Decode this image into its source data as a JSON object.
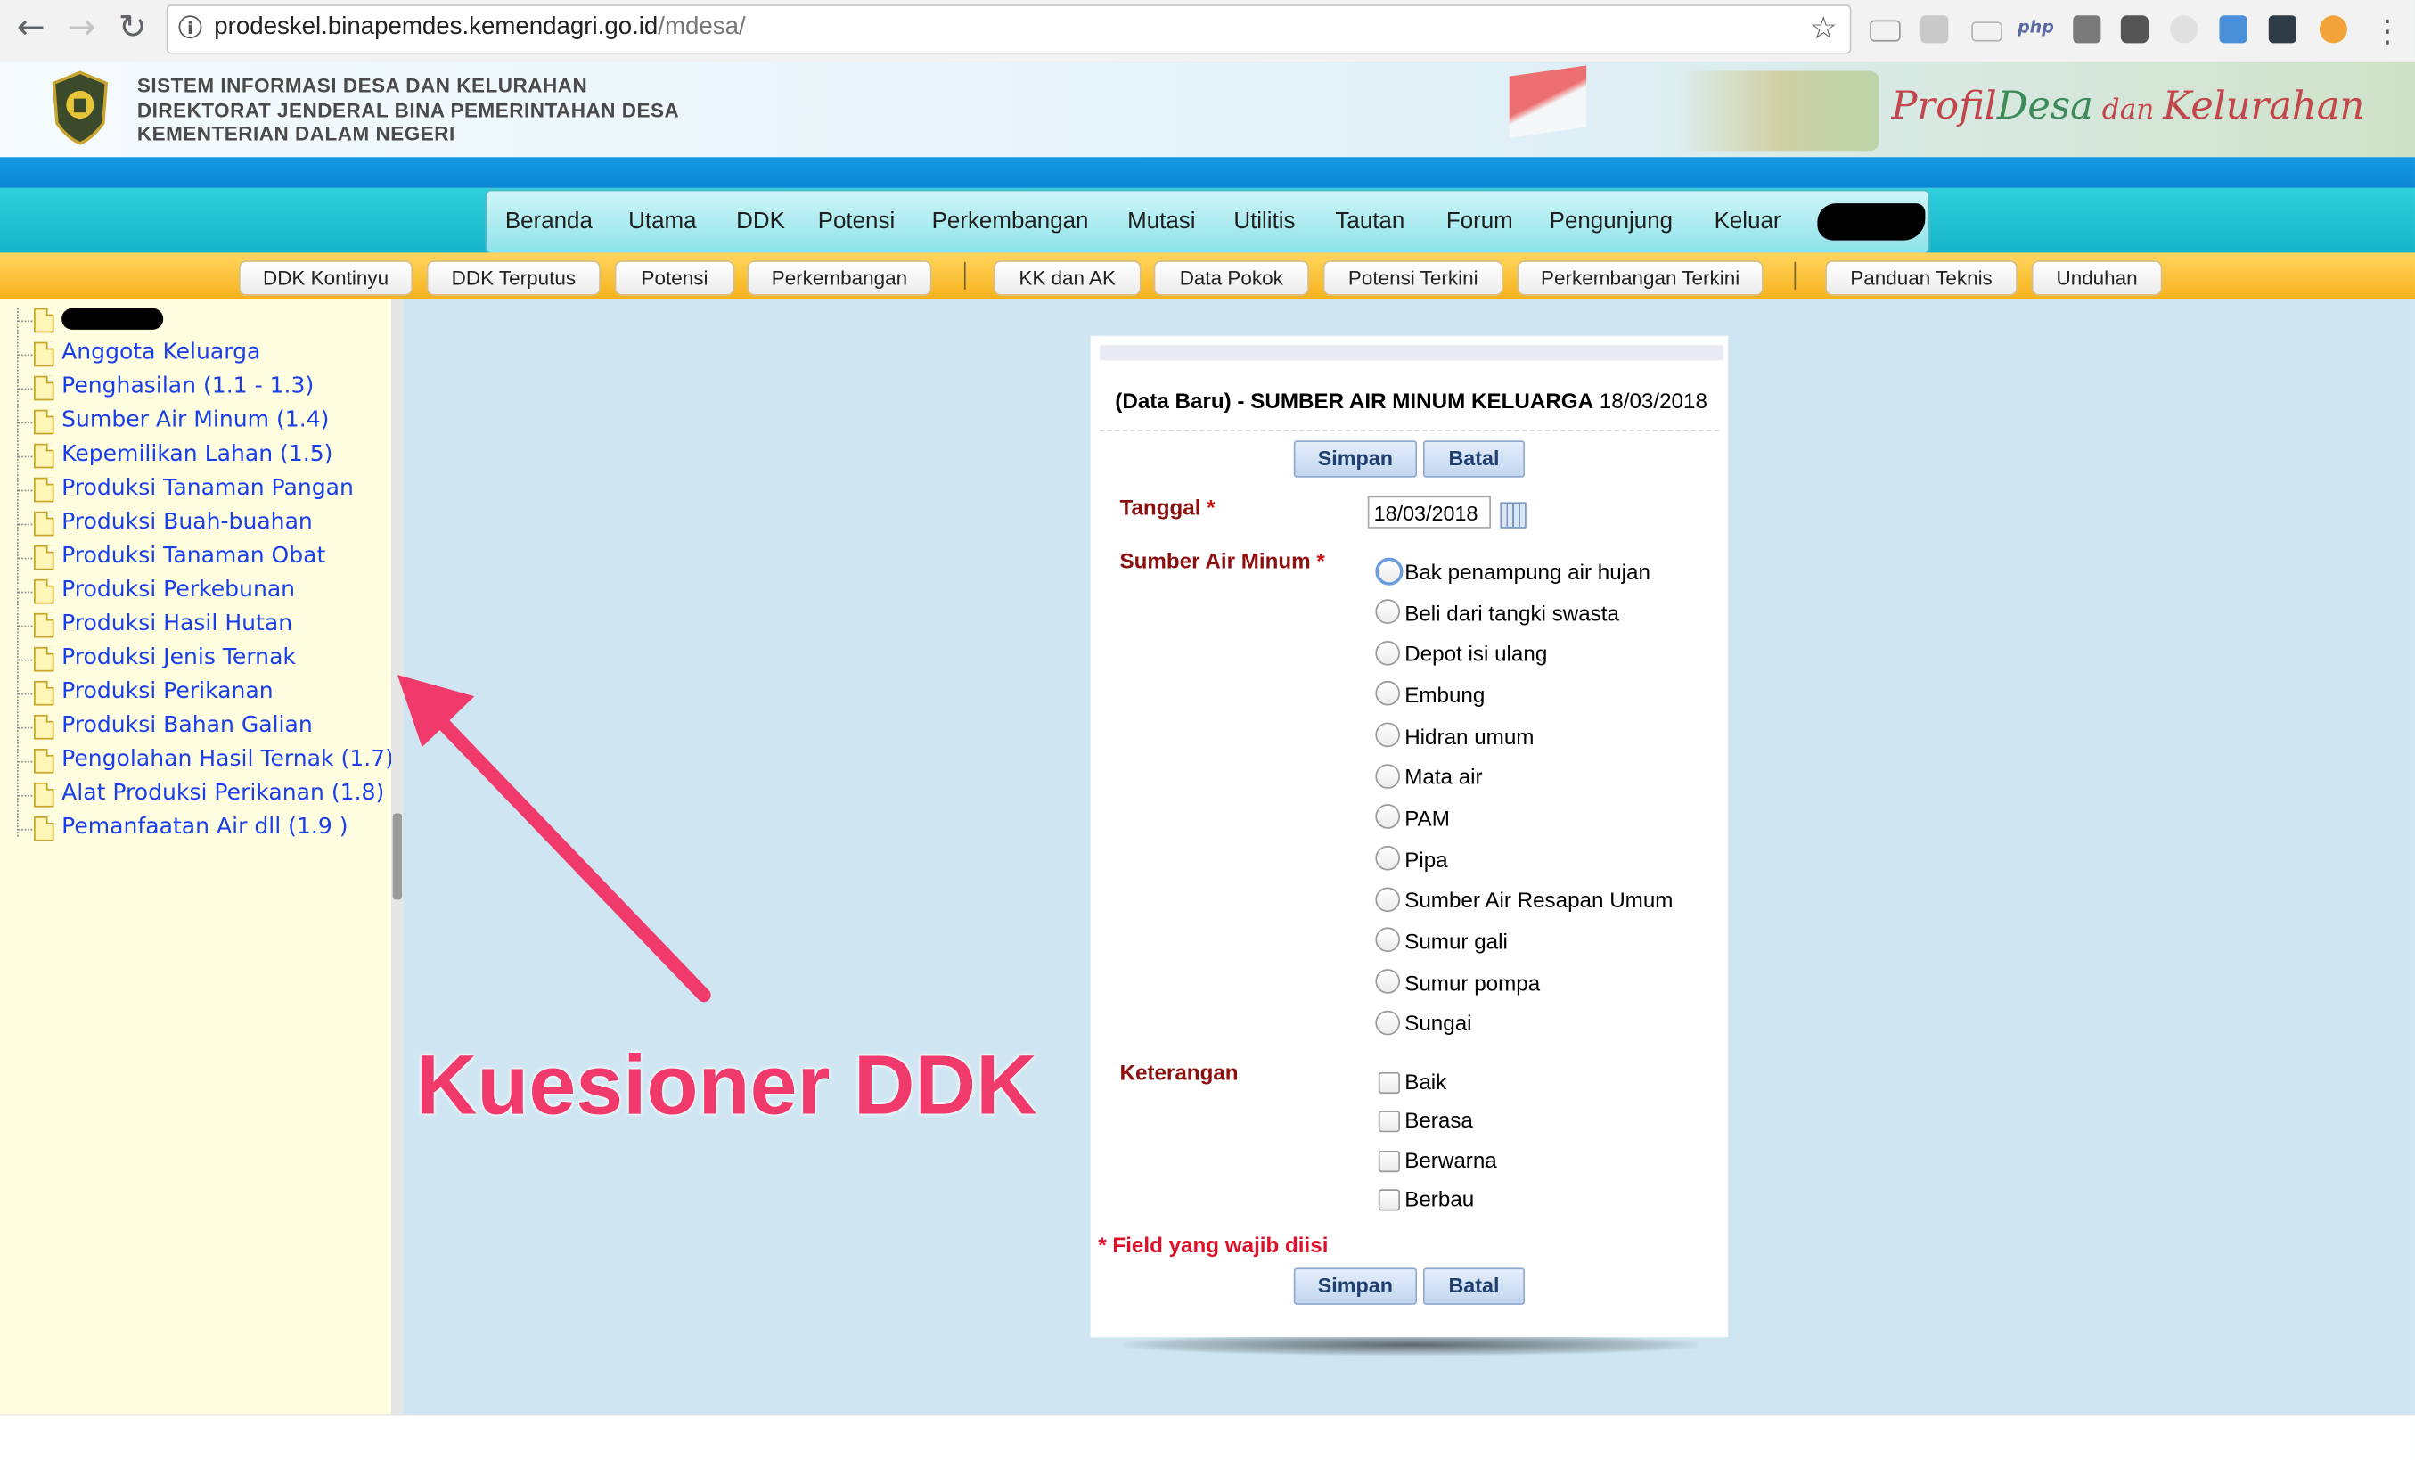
{
  "browser": {
    "url_host": "prodeskel.binapemdes.kemendagri.go.id",
    "url_path": "/mdesa/",
    "ext_php_label": "php"
  },
  "header": {
    "line1": "SISTEM INFORMASI DESA DAN KELURAHAN",
    "line2": "DIREKTORAT JENDERAL BINA PEMERINTAHAN DESA",
    "line3": "KEMENTERIAN DALAM NEGERI",
    "brand_part1": "Profil",
    "brand_part2": "Desa",
    "brand_part3": " dan ",
    "brand_part4": "Kelurahan"
  },
  "main_menu": [
    "Beranda",
    "Utama",
    "DDK",
    "Potensi",
    "Perkembangan",
    "Mutasi",
    "Utilitis",
    "Tautan",
    "Forum",
    "Pengunjung",
    "Keluar"
  ],
  "sub_menu": [
    "DDK Kontinyu",
    "DDK Terputus",
    "Potensi",
    "Perkembangan",
    "KK dan AK",
    "Data Pokok",
    "Potensi Terkini",
    "Perkembangan Terkini",
    "Panduan Teknis",
    "Unduhan"
  ],
  "sidebar": {
    "items": [
      "Anggota Keluarga",
      "Penghasilan (1.1 - 1.3)",
      "Sumber Air Minum (1.4)",
      "Kepemilikan Lahan (1.5)",
      "Produksi Tanaman Pangan",
      "Produksi Buah-buahan",
      "Produksi Tanaman Obat",
      "Produksi Perkebunan",
      "Produksi Hasil Hutan",
      "Produksi Jenis Ternak",
      "Produksi Perikanan",
      "Produksi Bahan Galian",
      "Pengolahan Hasil Ternak (1.7)",
      "Alat Produksi Perikanan (1.8)",
      "Pemanfaatan Air dll (1.9 )"
    ]
  },
  "annotation": {
    "text": "Kuesioner DDK",
    "color": "#ef3a6b"
  },
  "form": {
    "title_bold": "(Data Baru) - SUMBER AIR MINUM KELUARGA",
    "title_date": " 18/03/2018",
    "save_label": "Simpan",
    "cancel_label": "Batal",
    "tanggal_label": "Tanggal",
    "tanggal_value": "18/03/2018",
    "sumber_label": "Sumber Air Minum",
    "required_mark": "*",
    "sumber_options": [
      "Bak penampung air hujan",
      "Beli dari tangki swasta",
      "Depot isi ulang",
      "Embung",
      "Hidran umum",
      "Mata air",
      "PAM",
      "Pipa",
      "Sumber Air Resapan Umum",
      "Sumur gali",
      "Sumur pompa",
      "Sungai"
    ],
    "keterangan_label": "Keterangan",
    "keterangan_options": [
      "Baik",
      "Berasa",
      "Berwarna",
      "Berbau"
    ],
    "required_note": "* Field yang wajib diisi"
  }
}
